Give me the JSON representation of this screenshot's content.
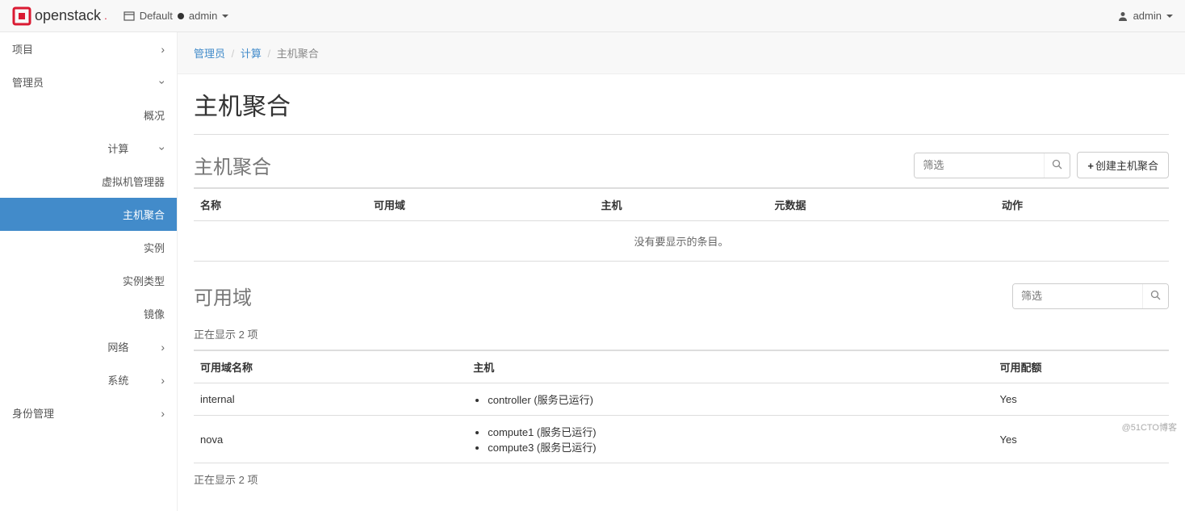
{
  "topbar": {
    "brand": "openstack",
    "domain_label": "Default",
    "project_label": "admin",
    "user_label": "admin"
  },
  "sidebar": {
    "project": "项目",
    "admin": "管理员",
    "overview": "概况",
    "compute": "计算",
    "hypervisors": "虚拟机管理器",
    "host_aggregates": "主机聚合",
    "instances": "实例",
    "flavors": "实例类型",
    "images": "镜像",
    "network": "网络",
    "system": "系统",
    "identity": "身份管理"
  },
  "breadcrumbs": {
    "admin": "管理员",
    "compute": "计算",
    "current": "主机聚合"
  },
  "page": {
    "title": "主机聚合"
  },
  "aggregates_panel": {
    "title": "主机聚合",
    "filter_placeholder": "筛选",
    "create_label": "创建主机聚合",
    "cols": {
      "name": "名称",
      "az": "可用域",
      "hosts": "主机",
      "metadata": "元数据",
      "actions": "动作"
    },
    "empty": "没有要显示的条目。"
  },
  "az_panel": {
    "title": "可用域",
    "filter_placeholder": "筛选",
    "count_text": "正在显示 2 项",
    "cols": {
      "name": "可用域名称",
      "hosts": "主机",
      "available": "可用配额"
    },
    "rows": [
      {
        "name": "internal",
        "hosts": [
          "controller (服务已运行)"
        ],
        "available": "Yes"
      },
      {
        "name": "nova",
        "hosts": [
          "compute1 (服务已运行)",
          "compute3 (服务已运行)"
        ],
        "available": "Yes"
      }
    ],
    "count_text_bottom": "正在显示 2 项"
  },
  "watermark": "@51CTO博客"
}
